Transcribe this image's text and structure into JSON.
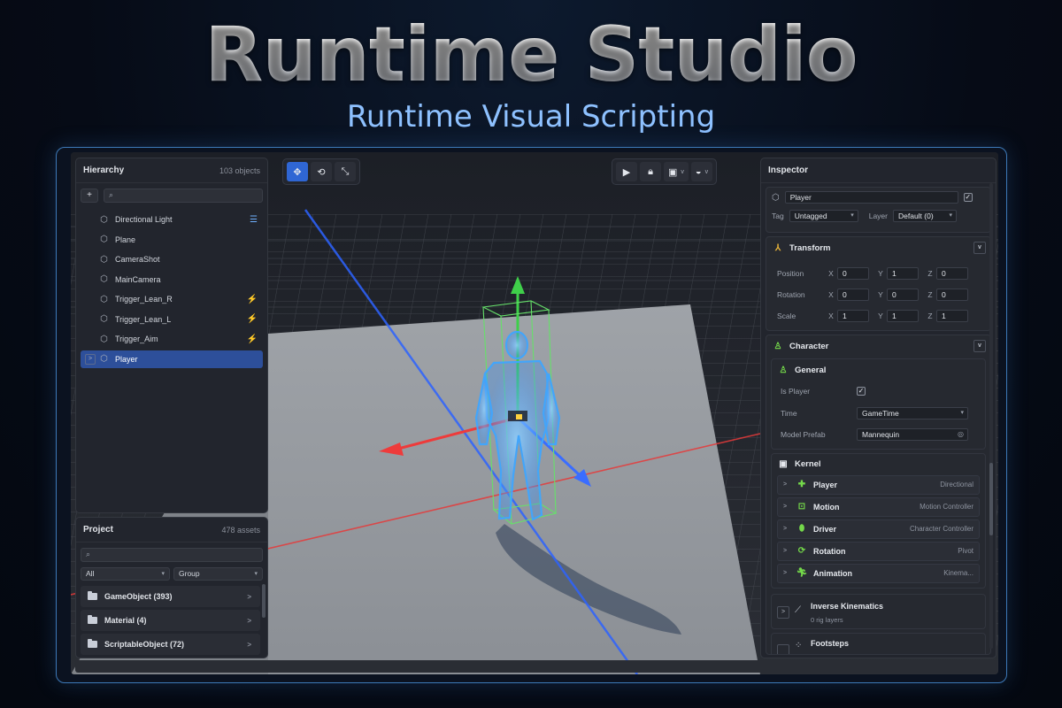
{
  "hero": {
    "title": "Runtime Studio",
    "subtitle": "Runtime Visual Scripting"
  },
  "hierarchy": {
    "title": "Hierarchy",
    "count": "103 objects",
    "add_label": "+",
    "items": [
      {
        "label": "Directional Light",
        "badge": "lines-icon"
      },
      {
        "label": "Plane",
        "badge": ""
      },
      {
        "label": "CameraShot",
        "badge": ""
      },
      {
        "label": "MainCamera",
        "badge": ""
      },
      {
        "label": "Trigger_Lean_R",
        "badge": "bolt-icon"
      },
      {
        "label": "Trigger_Lean_L",
        "badge": "bolt-icon"
      },
      {
        "label": "Trigger_Aim",
        "badge": "bolt-icon"
      },
      {
        "label": "Player",
        "badge": "",
        "selected": true
      }
    ]
  },
  "project": {
    "title": "Project",
    "count": "478 assets",
    "filter_type": "All",
    "filter_group": "Group",
    "folders": [
      {
        "label": "GameObject (393)"
      },
      {
        "label": "Material (4)"
      },
      {
        "label": "ScriptableObject (72)"
      }
    ]
  },
  "toolbar_left": {
    "tools": [
      "move-icon",
      "rotate-icon",
      "scale-icon"
    ],
    "active": "move-icon"
  },
  "toolbar_right": {
    "buttons": [
      "play-icon",
      "lock-icon",
      "snap-icon",
      "shading-icon"
    ],
    "chevron": "v"
  },
  "inspector": {
    "title": "Inspector",
    "object_name": "Player",
    "active_check": "✓",
    "tag_label": "Tag",
    "tag_value": "Untagged",
    "layer_label": "Layer",
    "layer_value": "Default (0)",
    "transform": {
      "title": "Transform",
      "rows": [
        {
          "label": "Position",
          "x": "0",
          "y": "1",
          "z": "0"
        },
        {
          "label": "Rotation",
          "x": "0",
          "y": "0",
          "z": "0"
        },
        {
          "label": "Scale",
          "x": "1",
          "y": "1",
          "z": "1"
        }
      ],
      "axis_x": "X",
      "axis_y": "Y",
      "axis_z": "Z"
    },
    "character": {
      "title": "Character",
      "general": {
        "title": "General",
        "is_player_label": "Is Player",
        "is_player_check": "✓",
        "time_label": "Time",
        "time_value": "GameTime",
        "model_label": "Model Prefab",
        "model_value": "Mannequin"
      },
      "kernel": {
        "title": "Kernel",
        "items": [
          {
            "label": "Player",
            "desc": "Directional"
          },
          {
            "label": "Motion",
            "desc": "Motion Controller"
          },
          {
            "label": "Driver",
            "desc": "Character Controller"
          },
          {
            "label": "Rotation",
            "desc": "Pivot"
          },
          {
            "label": "Animation",
            "desc": "Kinema..."
          }
        ]
      },
      "ik": {
        "title": "Inverse Kinematics",
        "sub": "0 rig layers"
      },
      "footsteps": {
        "title": "Footsteps"
      }
    },
    "chevron": "v",
    "expand": ">"
  },
  "colors": {
    "accent": "#2f66d4",
    "selection": "#2d4f9a",
    "kernel_icon": "#74d84a",
    "bolt": "#f1c232",
    "frame": "#3d79b8"
  }
}
